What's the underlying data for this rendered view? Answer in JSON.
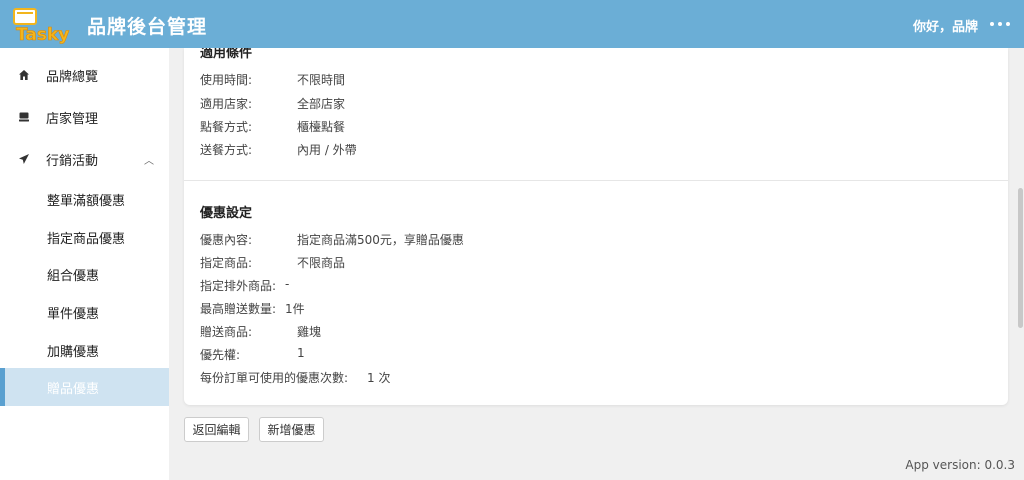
{
  "header": {
    "logo_text": "Tasky",
    "title": "品牌後台管理",
    "greeting": "你好，品牌"
  },
  "sidebar": {
    "items": [
      {
        "label": "品牌總覽",
        "icon": "home-icon"
      },
      {
        "label": "店家管理",
        "icon": "store-icon"
      },
      {
        "label": "行銷活動",
        "icon": "send-icon",
        "expanded": true
      }
    ],
    "sub_items": [
      {
        "label": "整單滿額優惠"
      },
      {
        "label": "指定商品優惠"
      },
      {
        "label": "組合優惠"
      },
      {
        "label": "單件優惠"
      },
      {
        "label": "加購優惠"
      },
      {
        "label": "贈品優惠",
        "active": true
      }
    ]
  },
  "conditions": {
    "title": "適用條件",
    "rows": [
      {
        "key": "使用時間:",
        "value": "不限時間"
      },
      {
        "key": "適用店家:",
        "value": "全部店家"
      },
      {
        "key": "點餐方式:",
        "value": "櫃檯點餐"
      },
      {
        "key": "送餐方式:",
        "value": "內用 / 外帶"
      }
    ]
  },
  "discount": {
    "title": "優惠設定",
    "rows": [
      {
        "key": "優惠內容:",
        "value": "指定商品滿500元，享贈品優惠"
      },
      {
        "key": "指定商品:",
        "value": "不限商品"
      },
      {
        "key": "指定排外商品:",
        "value": "-"
      },
      {
        "key": "最高贈送數量:",
        "value": "1件"
      },
      {
        "key": "贈送商品:",
        "value": "雞塊"
      },
      {
        "key": "優先權:",
        "value": "1"
      },
      {
        "key": "每份訂單可使用的優惠次數:",
        "value": "1 次"
      }
    ]
  },
  "actions": {
    "back_label": "返回編輯",
    "add_label": "新增優惠"
  },
  "footer": {
    "version": "App version: 0.0.3"
  },
  "colors": {
    "header": "#6baed6",
    "active_bg": "#cfe3f1",
    "active_bar": "#5aa0d0"
  }
}
